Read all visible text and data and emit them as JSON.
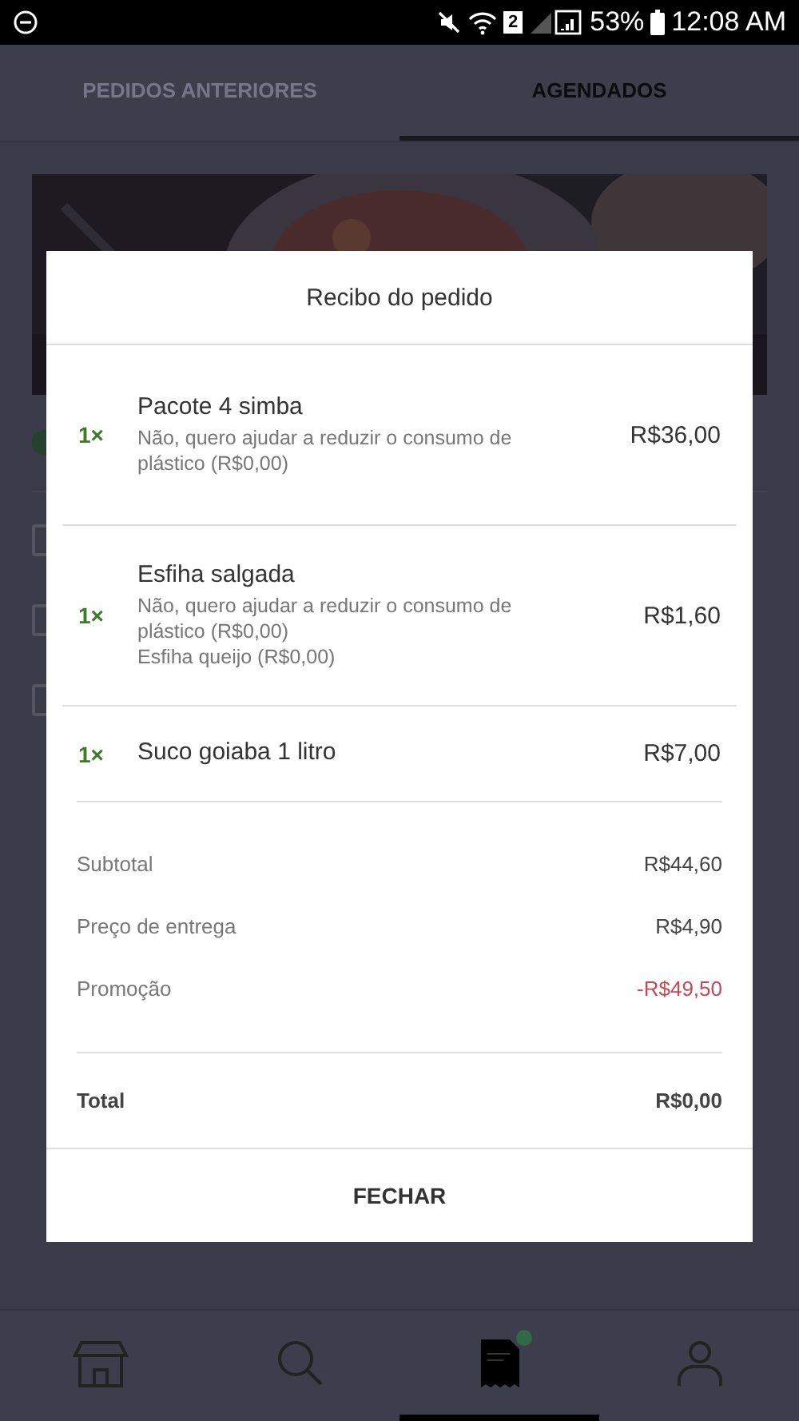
{
  "status_bar": {
    "sim": "2",
    "battery": "53%",
    "time": "12:08 AM"
  },
  "tabs": [
    {
      "label": "PEDIDOS ANTERIORES",
      "selected": false
    },
    {
      "label": "AGENDADOS",
      "selected": true
    }
  ],
  "receipt": {
    "title": "Recibo do pedido",
    "items": [
      {
        "quantity": "1×",
        "name": "Pacote 4 simba",
        "details": [
          "Não, quero ajudar a reduzir o consumo de plástico (R$0,00)"
        ],
        "price": "R$36,00"
      },
      {
        "quantity": "1×",
        "name": "Esfiha salgada",
        "details": [
          "Não, quero ajudar a reduzir o consumo de plástico (R$0,00)",
          "Esfiha queijo (R$0,00)"
        ],
        "price": "R$1,60"
      },
      {
        "quantity": "1×",
        "name": "Suco goiaba 1 litro",
        "price": "R$7,00"
      }
    ],
    "summary": [
      {
        "label": "Subtotal",
        "value": "R$44,60",
        "discount": false
      },
      {
        "label": "Preço de entrega",
        "value": "R$4,90",
        "discount": false
      },
      {
        "label": "Promoção",
        "value": "-R$49,50",
        "discount": true
      }
    ],
    "total": {
      "label": "Total",
      "value": "R$0,00"
    },
    "close_button": "FECHAR"
  },
  "bottom_nav": [
    {
      "kind": "store",
      "selected": false,
      "badge": false
    },
    {
      "kind": "search",
      "selected": false,
      "badge": false
    },
    {
      "kind": "orders",
      "selected": true,
      "badge": true
    },
    {
      "kind": "profile",
      "selected": false,
      "badge": false
    }
  ]
}
